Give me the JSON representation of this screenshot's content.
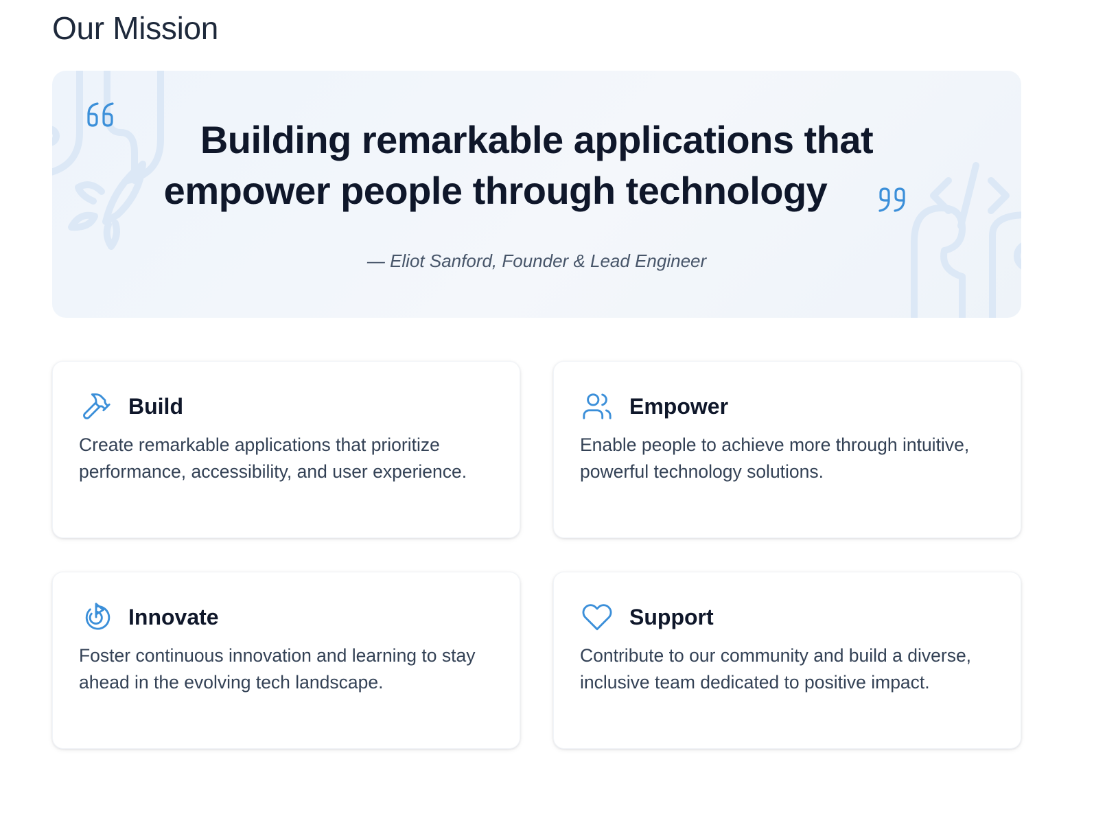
{
  "section": {
    "title": "Our Mission"
  },
  "hero": {
    "quote_line1": "Building remarkable applications that",
    "quote_line2": "empower people through technology",
    "attribution": "— Eliot Sanford, Founder & Lead Engineer"
  },
  "cards": [
    {
      "title": "Build",
      "icon": "hammer-icon",
      "text": "Create remarkable applications that prioritize performance, accessibility, and user experience."
    },
    {
      "title": "Empower",
      "icon": "users-icon",
      "text": "Enable people to achieve more through intuitive, powerful technology solutions."
    },
    {
      "title": "Innovate",
      "icon": "target-play-icon",
      "text": "Foster continuous innovation and learning to stay ahead in the evolving tech landscape."
    },
    {
      "title": "Support",
      "icon": "heart-icon",
      "text": "Contribute to our community and build a diverse, inclusive team dedicated to positive impact."
    }
  ],
  "colors": {
    "accent": "#3b8fd9",
    "hero_bg": "#f1f5fa",
    "text_dark": "#0f172a",
    "text_body": "#334155",
    "decoration": "#dce8f6"
  }
}
